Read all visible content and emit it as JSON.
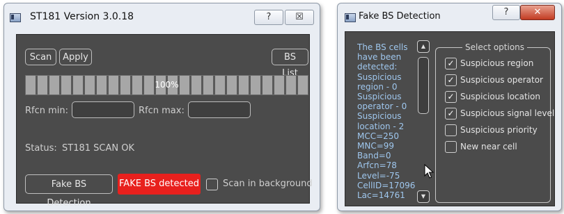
{
  "left_window": {
    "title": "ST181 Version 3.0.18",
    "help_label": "?",
    "close_label": "☒",
    "buttons": {
      "scan": "Scan",
      "apply": "Apply",
      "bs_list": "BS List"
    },
    "progress": {
      "text": "100%",
      "value": 1.0
    },
    "rfcn_min_label": "Rfcn min:",
    "rfcn_min_value": "",
    "rfcn_max_label": "Rfcn max:",
    "rfcn_max_value": "",
    "status_label": "Status:",
    "status_value": "ST181 SCAN OK",
    "fake_bs_button": "Fake BS Detection",
    "fake_bs_detected": "FAKE BS detected",
    "scan_background_label": "Scan in background",
    "scan_background_checked": false
  },
  "right_window": {
    "title": "Fake BS Detection",
    "help_label": "?",
    "close_label": "✕",
    "log_lines": [
      "The BS cells",
      "have been",
      "detected:",
      "Suspicious",
      "region - 0",
      "Suspicious",
      "operator - 0",
      "Suspicious",
      "location - 2",
      "MCC=250",
      "MNC=99",
      "Band=0",
      "Arfcn=78",
      "Level=-75",
      "CellID=17096",
      "Lac=14761"
    ],
    "group_title": "Select options",
    "options": [
      {
        "label": "Suspicious region",
        "checked": true
      },
      {
        "label": "Suspicious operator",
        "checked": true
      },
      {
        "label": "Suspicious location",
        "checked": true
      },
      {
        "label": "Suspicious signal level",
        "checked": true
      },
      {
        "label": "Suspicious priority",
        "checked": false
      },
      {
        "label": "New near cell",
        "checked": false
      }
    ],
    "check_mark": "✓"
  },
  "colors": {
    "panel": "#4b4b4b",
    "accent_red": "#e8201d",
    "log_text": "#9fc7ee"
  }
}
